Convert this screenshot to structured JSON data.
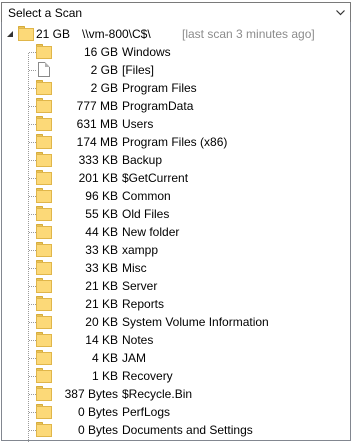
{
  "scan_selector": {
    "label": "Select a Scan"
  },
  "root": {
    "size": "21 GB",
    "path": "\\\\vm-800\\C$\\",
    "note": "[last scan 3 minutes ago]"
  },
  "items": [
    {
      "size": "16 GB",
      "name": "Windows",
      "icon": "folder-icon"
    },
    {
      "size": "2 GB",
      "name": "[Files]",
      "icon": "file-icon"
    },
    {
      "size": "2 GB",
      "name": "Program Files",
      "icon": "folder-icon"
    },
    {
      "size": "777 MB",
      "name": "ProgramData",
      "icon": "folder-icon"
    },
    {
      "size": "631 MB",
      "name": "Users",
      "icon": "folder-icon"
    },
    {
      "size": "174 MB",
      "name": "Program Files (x86)",
      "icon": "folder-icon"
    },
    {
      "size": "333 KB",
      "name": "Backup",
      "icon": "folder-icon"
    },
    {
      "size": "201 KB",
      "name": "$GetCurrent",
      "icon": "folder-icon"
    },
    {
      "size": "96 KB",
      "name": "Common",
      "icon": "folder-icon"
    },
    {
      "size": "55 KB",
      "name": "Old Files",
      "icon": "folder-icon"
    },
    {
      "size": "44 KB",
      "name": "New folder",
      "icon": "folder-icon"
    },
    {
      "size": "33 KB",
      "name": "xampp",
      "icon": "folder-icon"
    },
    {
      "size": "33 KB",
      "name": "Misc",
      "icon": "folder-icon"
    },
    {
      "size": "21 KB",
      "name": "Server",
      "icon": "folder-icon"
    },
    {
      "size": "21 KB",
      "name": "Reports",
      "icon": "folder-icon"
    },
    {
      "size": "20 KB",
      "name": "System Volume Information",
      "icon": "folder-icon"
    },
    {
      "size": "14 KB",
      "name": "Notes",
      "icon": "folder-icon"
    },
    {
      "size": "4 KB",
      "name": "JAM",
      "icon": "folder-icon"
    },
    {
      "size": "1 KB",
      "name": "Recovery",
      "icon": "folder-icon"
    },
    {
      "size": "387 Bytes",
      "name": "$Recycle.Bin",
      "icon": "folder-icon"
    },
    {
      "size": "0 Bytes",
      "name": "PerfLogs",
      "icon": "folder-icon"
    },
    {
      "size": "0 Bytes",
      "name": "Documents and Settings",
      "icon": "folder-icon"
    }
  ]
}
